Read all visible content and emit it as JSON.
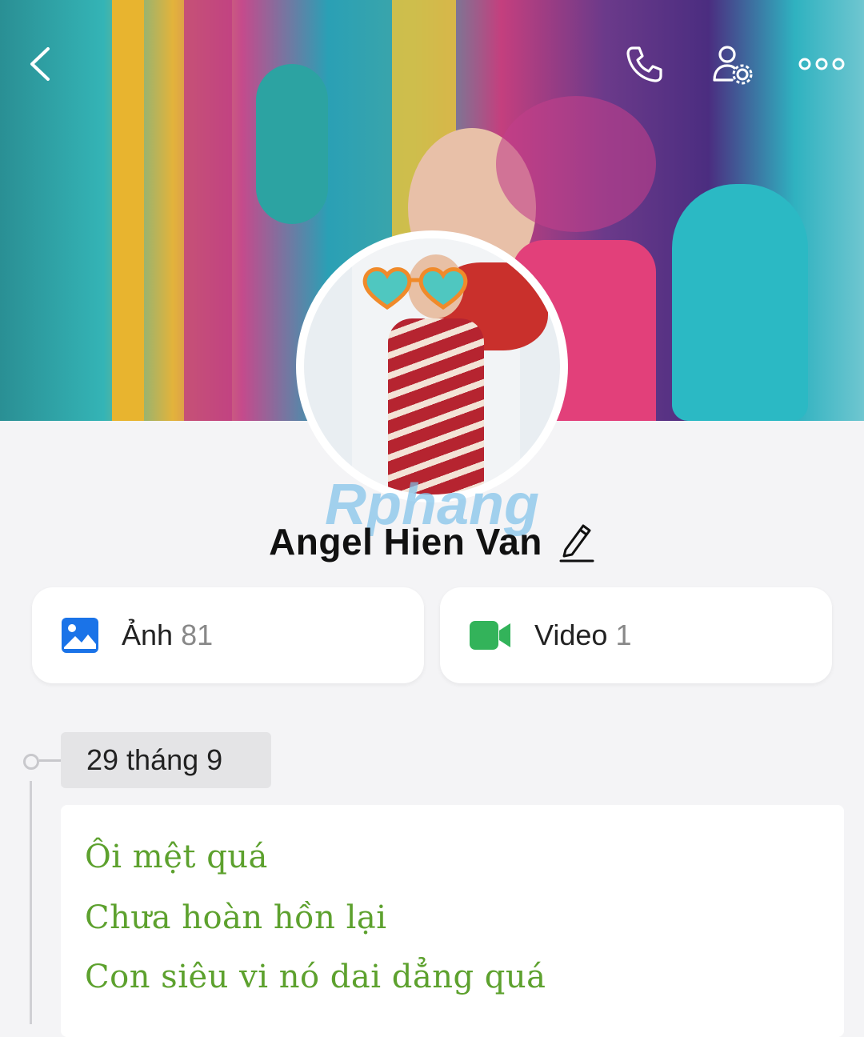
{
  "header": {
    "back_icon": "chevron-left-icon",
    "call_icon": "phone-icon",
    "profile_settings_icon": "user-gear-icon",
    "more_icon": "more-horizontal-icon"
  },
  "profile": {
    "name": "Angel Hien Van",
    "edit_icon": "pencil-icon",
    "watermark": "Rphang"
  },
  "media": {
    "photos": {
      "label": "Ảnh",
      "count": "81",
      "icon": "image-icon",
      "color": "#1a73e8"
    },
    "videos": {
      "label": "Video",
      "count": "1",
      "icon": "video-camera-icon",
      "color": "#33b35a"
    }
  },
  "timeline": {
    "date": "29 tháng 9",
    "post": {
      "lines": [
        "Ôi mệt quá",
        "Chưa hoàn hồn lại",
        "Con siêu vi nó dai dẳng quá"
      ],
      "text_color": "#5da12e"
    }
  }
}
